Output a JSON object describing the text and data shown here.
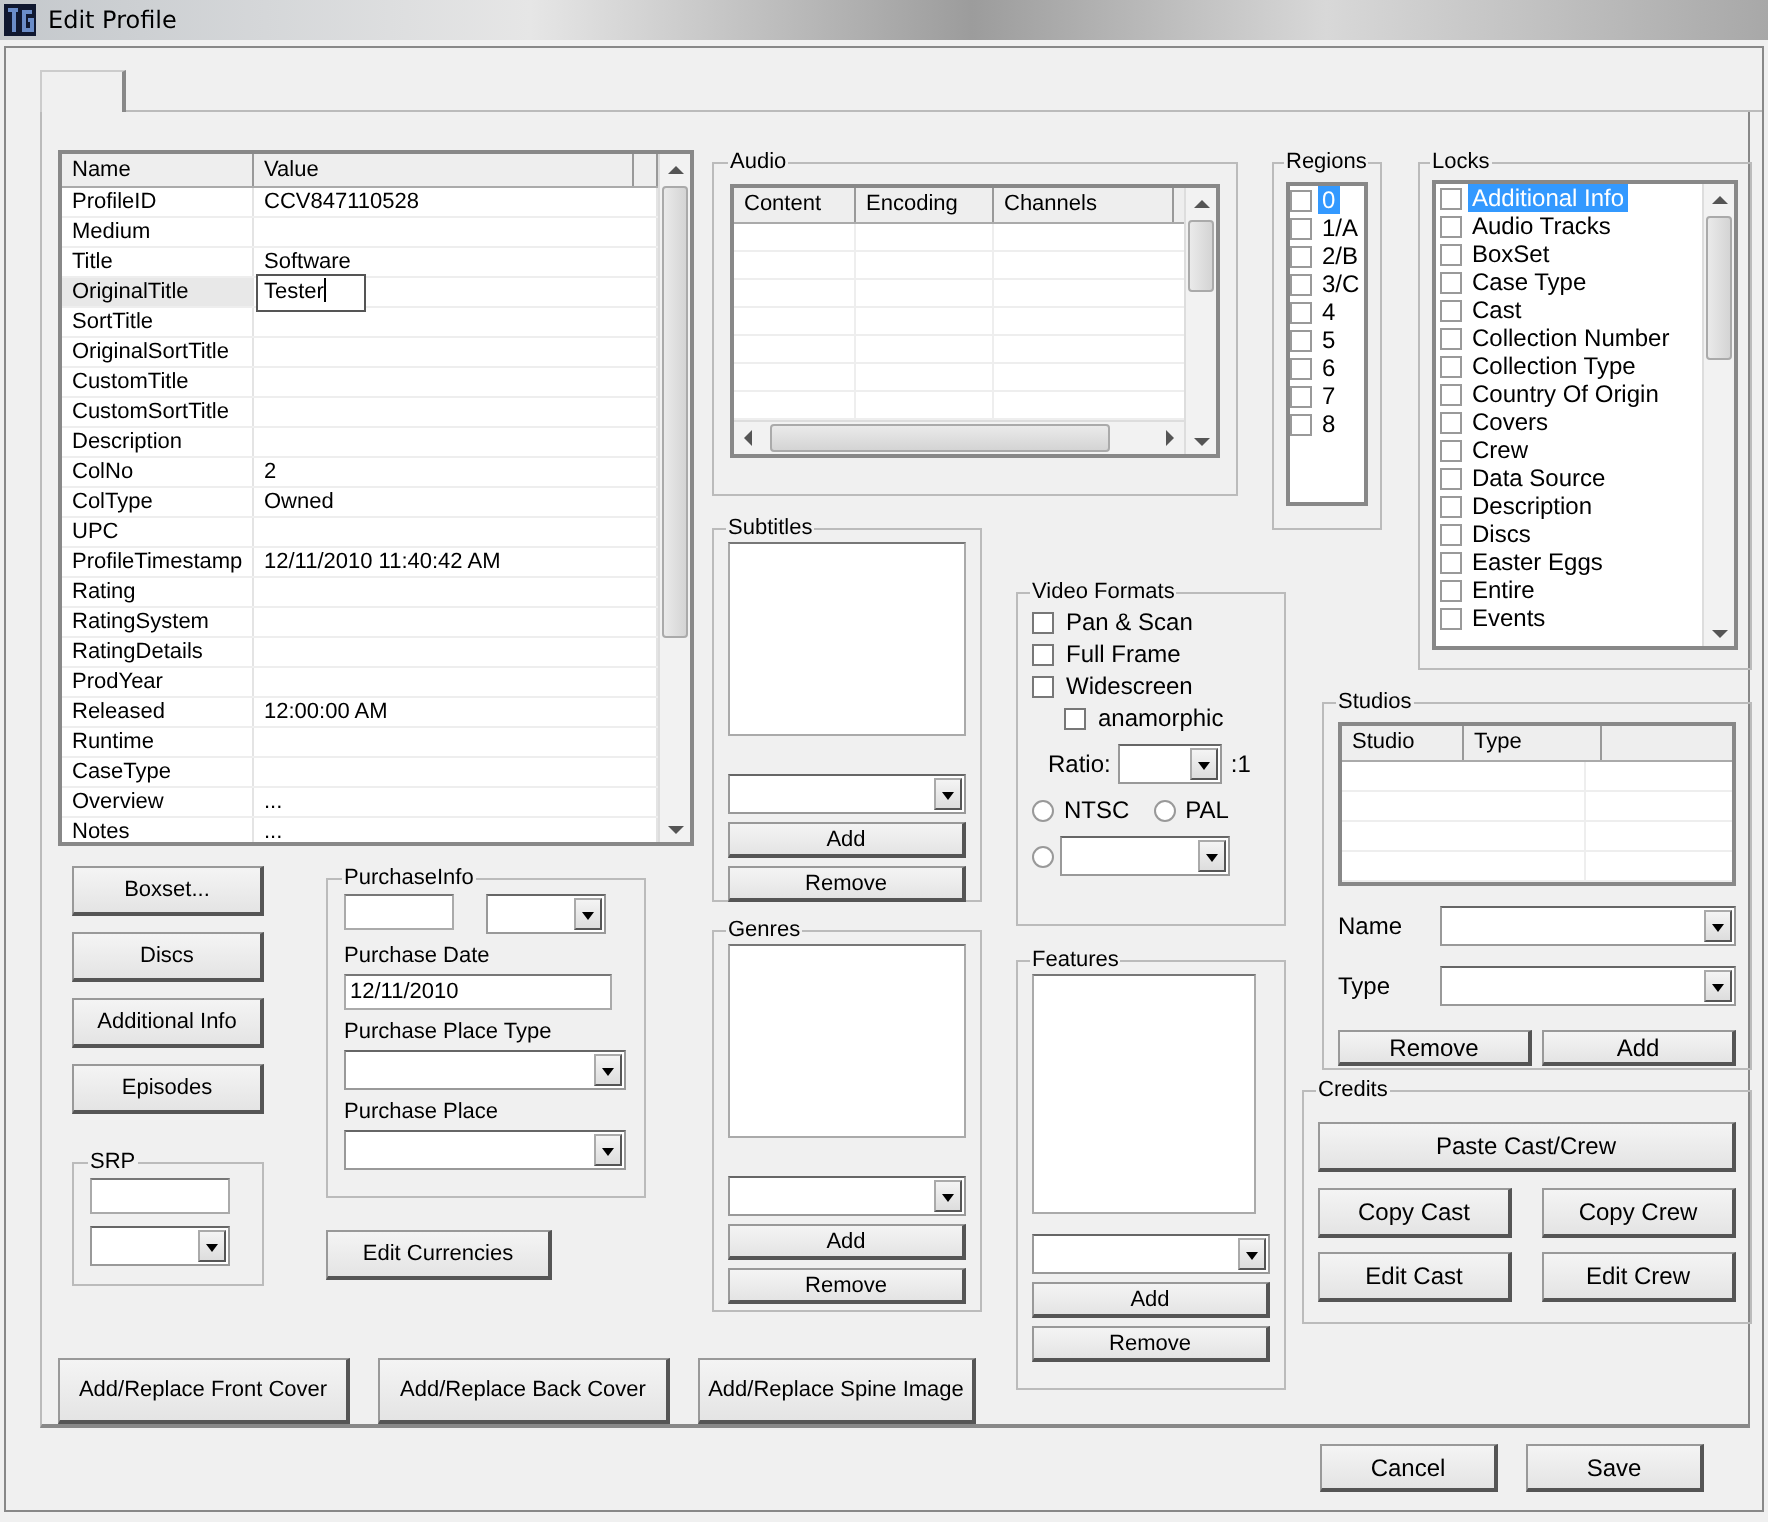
{
  "window": {
    "title": "Edit Profile"
  },
  "properties": {
    "columns": [
      "Name",
      "Value"
    ],
    "rows": [
      {
        "name": "ProfileID",
        "value": "CCV847110528",
        "selected": false
      },
      {
        "name": "Medium",
        "selected": false
      },
      {
        "name": "Title",
        "value": "Software",
        "selected": false
      },
      {
        "name": "OriginalTitle",
        "editing": "Tester",
        "selected": true
      },
      {
        "name": "SortTitle",
        "selected": false
      },
      {
        "name": "OriginalSortTitle",
        "selected": false
      },
      {
        "name": "CustomTitle",
        "selected": false
      },
      {
        "name": "CustomSortTitle",
        "selected": false
      },
      {
        "name": "Description",
        "selected": false
      },
      {
        "name": "ColNo",
        "value": "2",
        "selected": false
      },
      {
        "name": "ColType",
        "value": "Owned",
        "selected": false
      },
      {
        "name": "UPC",
        "selected": false
      },
      {
        "name": "ProfileTimestamp",
        "value": "12/11/2010 11:40:42 AM",
        "selected": false
      },
      {
        "name": "Rating",
        "selected": false
      },
      {
        "name": "RatingSystem",
        "selected": false
      },
      {
        "name": "RatingDetails",
        "selected": false
      },
      {
        "name": "ProdYear",
        "selected": false
      },
      {
        "name": "Released",
        "value": "12:00:00 AM",
        "selected": false
      },
      {
        "name": "Runtime",
        "selected": false
      },
      {
        "name": "CaseType",
        "selected": false
      },
      {
        "name": "Overview",
        "value": "...",
        "selected": false
      },
      {
        "name": "Notes",
        "value": "...",
        "selected": false
      }
    ]
  },
  "audio": {
    "title": "Audio",
    "columns": [
      "Content",
      "Encoding",
      "Channels"
    ]
  },
  "regions": {
    "title": "Regions",
    "items": [
      {
        "label": "0",
        "checked": false,
        "selected": true
      },
      {
        "label": "1/A",
        "checked": false,
        "selected": false
      },
      {
        "label": "2/B",
        "checked": false,
        "selected": false
      },
      {
        "label": "3/C",
        "checked": false,
        "selected": false
      },
      {
        "label": "4",
        "checked": false,
        "selected": false
      },
      {
        "label": "5",
        "checked": false,
        "selected": false
      },
      {
        "label": "6",
        "checked": false,
        "selected": false
      },
      {
        "label": "7",
        "checked": false,
        "selected": false
      },
      {
        "label": "8",
        "checked": false,
        "selected": false
      }
    ]
  },
  "locks": {
    "title": "Locks",
    "items": [
      {
        "label": "Additional Info",
        "checked": false,
        "selected": true
      },
      {
        "label": "Audio Tracks",
        "checked": false,
        "selected": false
      },
      {
        "label": "BoxSet",
        "checked": false,
        "selected": false
      },
      {
        "label": "Case Type",
        "checked": false,
        "selected": false
      },
      {
        "label": "Cast",
        "checked": false,
        "selected": false
      },
      {
        "label": "Collection Number",
        "checked": false,
        "selected": false
      },
      {
        "label": "Collection Type",
        "checked": false,
        "selected": false
      },
      {
        "label": "Country Of Origin",
        "checked": false,
        "selected": false
      },
      {
        "label": "Covers",
        "checked": false,
        "selected": false
      },
      {
        "label": "Crew",
        "checked": false,
        "selected": false
      },
      {
        "label": "Data Source",
        "checked": false,
        "selected": false
      },
      {
        "label": "Description",
        "checked": false,
        "selected": false
      },
      {
        "label": "Discs",
        "checked": false,
        "selected": false
      },
      {
        "label": "Easter Eggs",
        "checked": false,
        "selected": false
      },
      {
        "label": "Entire",
        "checked": false,
        "selected": false
      },
      {
        "label": "Events",
        "checked": false,
        "selected": false
      }
    ]
  },
  "subtitles": {
    "title": "Subtitles",
    "buttons": [
      "Add",
      "Remove"
    ]
  },
  "genres": {
    "title": "Genres",
    "buttons": [
      "Add",
      "Remove"
    ]
  },
  "video_formats": {
    "title": "Video Formats",
    "options": [
      {
        "label": "Pan & Scan",
        "checked": false
      },
      {
        "label": "Full Frame",
        "checked": false
      },
      {
        "label": "Widescreen",
        "checked": false,
        "children": [
          {
            "label": "anamorphic",
            "checked": false
          }
        ]
      }
    ],
    "ratio_label": "Ratio:",
    "ratio_suffix": ":1",
    "radios": [
      {
        "label": "NTSC",
        "selected": false
      },
      {
        "label": "PAL",
        "selected": false
      }
    ],
    "other_radio": {
      "selected": false
    }
  },
  "features": {
    "title": "Features",
    "buttons": [
      "Add",
      "Remove"
    ]
  },
  "studios": {
    "title": "Studios",
    "columns": [
      "Studio",
      "Type"
    ],
    "fields": [
      "Name",
      "Type"
    ],
    "buttons": [
      "Remove",
      "Add"
    ]
  },
  "credits": {
    "title": "Credits",
    "buttons": [
      "Paste Cast/Crew",
      "Copy Cast",
      "Copy Crew",
      "Edit Cast",
      "Edit Crew"
    ]
  },
  "left_buttons": [
    "Boxset...",
    "Discs",
    "Additional Info",
    "Episodes"
  ],
  "srp": {
    "title": "SRP"
  },
  "purchase": {
    "title": "PurchaseInfo",
    "date_label": "Purchase Date",
    "date": "12/11/2010",
    "place_type_label": "Purchase Place Type",
    "place_label": "Purchase Place"
  },
  "edit_currencies": "Edit Currencies",
  "cover_buttons": [
    "Add/Replace Front Cover",
    "Add/Replace Back Cover",
    "Add/Replace Spine Image"
  ],
  "dialog_buttons": [
    "Cancel",
    "Save"
  ]
}
